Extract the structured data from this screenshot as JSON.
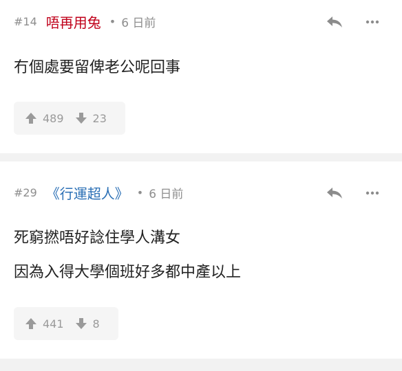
{
  "posts": [
    {
      "number": "#14",
      "username": "唔再用兔",
      "username_color": "#c0001a",
      "separator": "•",
      "time": "6 日前",
      "lines": [
        "冇個處要留俾老公呢回事"
      ],
      "upvotes": "489",
      "downvotes": "23"
    },
    {
      "number": "#29",
      "username": "《行運超人》",
      "username_color": "#2a6fb5",
      "separator": "•",
      "time": "6 日前",
      "lines": [
        "死窮撚唔好諗住學人溝女",
        "因為入得大學個班好多都中產以上"
      ],
      "upvotes": "441",
      "downvotes": "8"
    }
  ],
  "icons": {
    "reply": "reply-icon",
    "more": "more-icon",
    "up": "arrow-up-icon",
    "down": "arrow-down-icon"
  }
}
